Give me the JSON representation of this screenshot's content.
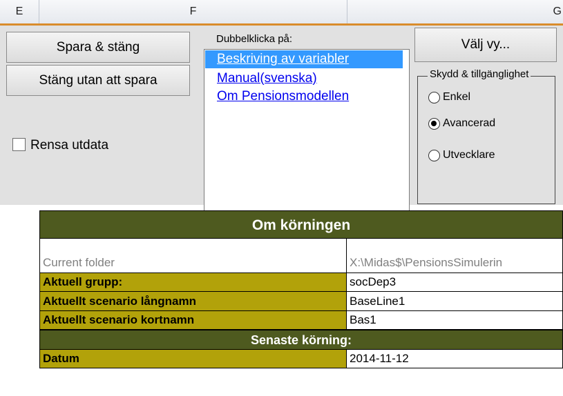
{
  "columns": {
    "e": "E",
    "f": "F",
    "g": "G"
  },
  "panel": {
    "save_close": "Spara & stäng",
    "close_nosave": "Stäng utan att spara",
    "clear_output": "Rensa utdata",
    "list_caption": "Dubbelklicka på:",
    "list_items": [
      "Beskriving av variabler",
      "Manual(svenska)",
      "Om Pensionsmodellen"
    ],
    "choose_view": "Välj vy...",
    "group_caption": "Skydd & tillgänglighet",
    "radios": [
      "Enkel",
      "Avancerad",
      "Utvecklare"
    ],
    "selected_radio": "Avancerad"
  },
  "sheet": {
    "title": "Om körningen",
    "current_folder_label": "Current folder",
    "current_folder_value": "X:\\Midas$\\PensionsSimulerin",
    "rows": [
      {
        "label": "Aktuell grupp:",
        "value": "socDep3"
      },
      {
        "label": "Aktuellt scenario långnamn",
        "value": "BaseLine1"
      },
      {
        "label": "Aktuellt scenario kortnamn",
        "value": "Bas1"
      }
    ],
    "latest_run": "Senaste körning:",
    "date_label": "Datum",
    "date_value": "2014-11-12"
  }
}
